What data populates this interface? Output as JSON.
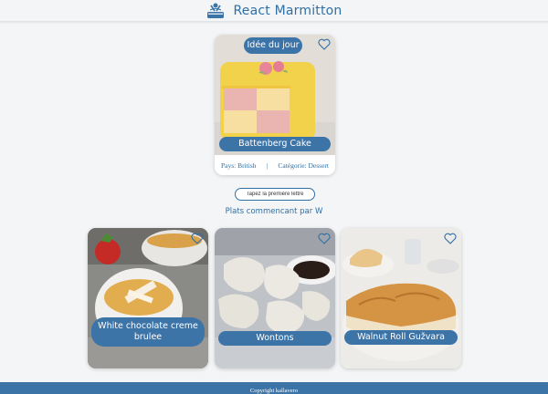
{
  "header": {
    "title": "React Marmitton",
    "logo_icon": "chef-logo-icon"
  },
  "featured": {
    "badge": "Idée du jour",
    "name": "Battenberg Cake",
    "country": "Pays: British",
    "separator": "|",
    "category": "Catégorie: Dessert",
    "favorite_icon": "heart-outline-icon"
  },
  "search": {
    "placeholder": "Tapez la première lettre",
    "value": ""
  },
  "results": {
    "title": "Plats commencant par W",
    "items": [
      {
        "name": "White chocolate creme brulee",
        "favorite_icon": "heart-outline-icon"
      },
      {
        "name": "Wontons",
        "favorite_icon": "heart-outline-icon"
      },
      {
        "name": "Walnut Roll Gužvara",
        "favorite_icon": "heart-outline-icon"
      }
    ]
  },
  "footer": {
    "text": "Copyright kallavero"
  },
  "colors": {
    "primary": "#3d74a8",
    "text_accent": "#2f6fa6",
    "background": "#f4f5f6"
  }
}
